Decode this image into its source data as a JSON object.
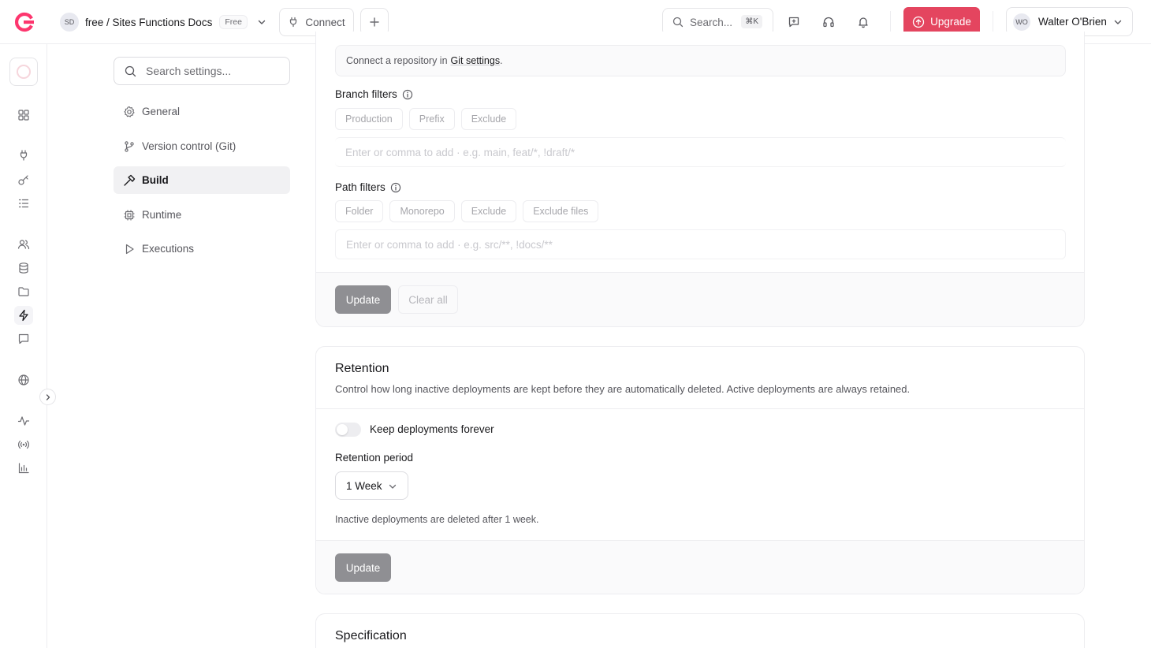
{
  "topbar": {
    "project_initials": "SD",
    "project_name": "free / Sites Functions Docs",
    "plan_badge": "Free",
    "connect_label": "Connect",
    "search_placeholder": "Search...",
    "search_shortcut": "⌘K",
    "upgrade_label": "Upgrade",
    "user_initials": "WO",
    "user_name": "Walter O'Brien",
    "accent_color": "#e4455f"
  },
  "rail": {
    "items": [
      "overview-icon",
      "plug-icon",
      "key-icon",
      "list-icon",
      "users-icon",
      "database-icon",
      "folder-icon",
      "bolt-icon",
      "message-icon",
      "globe-icon",
      "activity-icon",
      "signal-icon",
      "bar-chart-icon"
    ],
    "active": "bolt-icon"
  },
  "settings_nav": {
    "search_placeholder": "Search settings...",
    "items": [
      {
        "label": "General",
        "icon": "gear-icon"
      },
      {
        "label": "Version control (Git)",
        "icon": "git-branch-icon"
      },
      {
        "label": "Build",
        "icon": "hammer-icon"
      },
      {
        "label": "Runtime",
        "icon": "chip-icon"
      },
      {
        "label": "Executions",
        "icon": "play-icon"
      }
    ],
    "active": "Build"
  },
  "filters_card": {
    "connect_text": "Connect a repository in",
    "connect_link": "Git settings",
    "connect_suffix": ".",
    "branch_filters_label": "Branch filters",
    "branch_chips": [
      "Production",
      "Prefix",
      "Exclude"
    ],
    "branch_placeholder": "Enter or comma to add · e.g. main, feat/*, !draft/*",
    "path_filters_label": "Path filters",
    "path_chips": [
      "Folder",
      "Monorepo",
      "Exclude",
      "Exclude files"
    ],
    "path_placeholder": "Enter or comma to add · e.g. src/**, !docs/**",
    "update_label": "Update",
    "clear_label": "Clear all"
  },
  "retention_card": {
    "title": "Retention",
    "description": "Control how long inactive deployments are kept before they are automatically deleted. Active deployments are always retained.",
    "toggle_label": "Keep deployments forever",
    "toggle_on": false,
    "period_label": "Retention period",
    "period_value": "1 Week",
    "helper": "Inactive deployments are deleted after 1 week.",
    "update_label": "Update"
  },
  "specification_card": {
    "title": "Specification"
  }
}
